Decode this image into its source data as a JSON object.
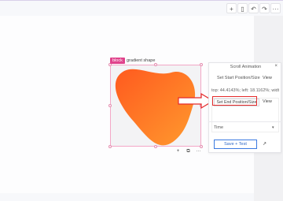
{
  "toolbar": {
    "buttons": [
      {
        "name": "add-icon",
        "glyph": "+"
      },
      {
        "name": "panel-icon",
        "glyph": "▯"
      },
      {
        "name": "undo-icon",
        "glyph": "↶"
      },
      {
        "name": "redo-icon",
        "glyph": "↷"
      },
      {
        "name": "more-icon",
        "glyph": "···"
      }
    ]
  },
  "element": {
    "tag": "block",
    "name": "gradient shape",
    "gradient_colors": [
      "#ff5a1f",
      "#ff9a2e"
    ]
  },
  "mini_toolbar": {
    "items": [
      "+",
      "⧉",
      "···"
    ]
  },
  "scroll_panel": {
    "title": "Scroll Animation",
    "close_glyph": "×",
    "start_button": "Set Start Position/Size",
    "start_view": "View",
    "position_text": "top: 44.4143%; left: 18.1162%; width",
    "end_button": "Set End Position/Size",
    "end_view": "View",
    "time_label": "Time",
    "time_caret": "▾",
    "save_button": "Save + Test",
    "edit_glyph": "↗"
  },
  "colors": {
    "highlight": "#e52b2b",
    "tag_bg": "#e0438c",
    "save_accent": "#2e68c8"
  }
}
